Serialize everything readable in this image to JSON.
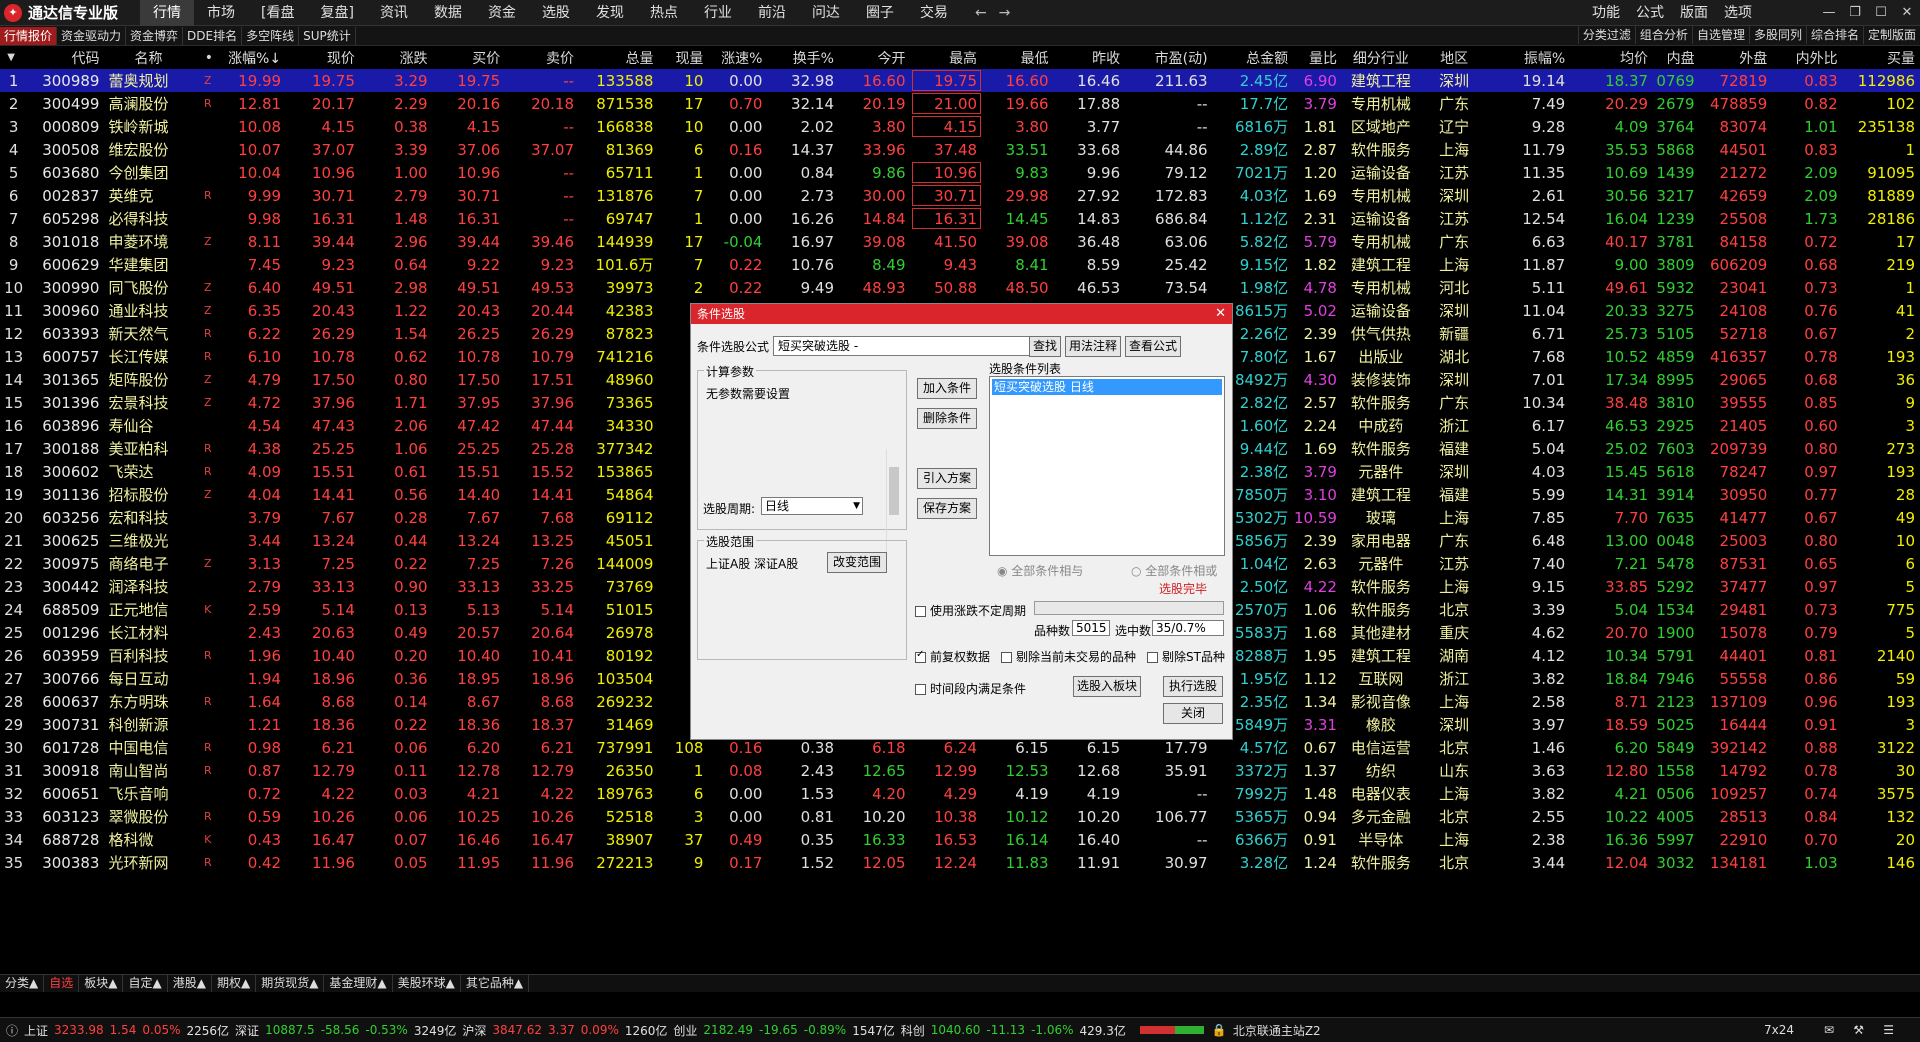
{
  "app": {
    "title": "通达信专业版"
  },
  "menu": [
    "行情",
    "市场",
    "[看盘",
    "复盘]",
    "资讯",
    "数据",
    "资金",
    "选股",
    "发现",
    "热点",
    "行业",
    "前沿",
    "问达",
    "圈子",
    "交易"
  ],
  "right_menu": [
    "功能",
    "公式",
    "版面",
    "选项"
  ],
  "tabs": [
    "行情报价",
    "资金驱动力",
    "资金博弈",
    "DDE排名",
    "多空阵线",
    "SUP统计"
  ],
  "right_tabs": [
    "分类过滤",
    "组合分析",
    "自选管理",
    "多股同列",
    "综合排名",
    "定制版面"
  ],
  "columns": [
    "代码",
    "名称",
    "•",
    "涨幅%↓",
    "现价",
    "涨跌",
    "买价",
    "卖价",
    "总量",
    "现量",
    "涨速%",
    "换手%",
    "今开",
    "最高",
    "最低",
    "昨收",
    "市盈(动)",
    "总金额",
    "量比",
    "细分行业",
    "地区",
    "振幅%",
    "均价",
    "内盘",
    "外盘",
    "内外比",
    "买量"
  ],
  "rows": [
    [
      "300989",
      "蕾奥规划",
      "Z",
      "19.99",
      "19.75",
      "3.29",
      "19.75",
      "--",
      "133588",
      "10",
      "0.00",
      "32.98",
      "16.60",
      "19.75",
      "16.60",
      "16.46",
      "211.63",
      "2.45亿",
      "6.90",
      "建筑工程",
      "深圳",
      "19.14",
      "18.37",
      "0769",
      "72819",
      "0.83",
      "112986"
    ],
    [
      "300499",
      "高澜股份",
      "R",
      "12.81",
      "20.17",
      "2.29",
      "20.16",
      "20.18",
      "871538",
      "17",
      "0.70",
      "32.14",
      "20.19",
      "21.00",
      "19.66",
      "17.88",
      "--",
      "17.7亿",
      "3.79",
      "专用机械",
      "广东",
      "7.49",
      "20.29",
      "2679",
      "478859",
      "0.82",
      "102"
    ],
    [
      "000809",
      "铁岭新城",
      "",
      "10.08",
      "4.15",
      "0.38",
      "4.15",
      "--",
      "166838",
      "10",
      "0.00",
      "2.02",
      "3.80",
      "4.15",
      "3.80",
      "3.77",
      "--",
      "6816万",
      "1.81",
      "区域地产",
      "辽宁",
      "9.28",
      "4.09",
      "3764",
      "83074",
      "1.01",
      "235138"
    ],
    [
      "300508",
      "维宏股份",
      "",
      "10.07",
      "37.07",
      "3.39",
      "37.06",
      "37.07",
      "81369",
      "6",
      "0.16",
      "14.37",
      "33.96",
      "37.48",
      "33.51",
      "33.68",
      "44.86",
      "2.89亿",
      "2.87",
      "软件服务",
      "上海",
      "11.79",
      "35.53",
      "5868",
      "44501",
      "0.83",
      "1"
    ],
    [
      "603680",
      "今创集团",
      "",
      "10.04",
      "10.96",
      "1.00",
      "10.96",
      "--",
      "65711",
      "1",
      "0.00",
      "0.84",
      "9.86",
      "10.96",
      "9.83",
      "9.96",
      "79.12",
      "7021万",
      "1.20",
      "运输设备",
      "江苏",
      "11.35",
      "10.69",
      "1439",
      "21272",
      "2.09",
      "91095"
    ],
    [
      "002837",
      "英维克",
      "R",
      "9.99",
      "30.71",
      "2.79",
      "30.71",
      "--",
      "131876",
      "7",
      "0.00",
      "2.73",
      "30.00",
      "30.71",
      "29.98",
      "27.92",
      "172.83",
      "4.03亿",
      "1.69",
      "专用机械",
      "深圳",
      "2.61",
      "30.56",
      "3217",
      "42659",
      "2.09",
      "81889"
    ],
    [
      "605298",
      "必得科技",
      "",
      "9.98",
      "16.31",
      "1.48",
      "16.31",
      "--",
      "69747",
      "1",
      "0.00",
      "16.26",
      "14.84",
      "16.31",
      "14.45",
      "14.83",
      "686.84",
      "1.12亿",
      "2.31",
      "运输设备",
      "江苏",
      "12.54",
      "16.04",
      "1239",
      "25508",
      "1.73",
      "28186"
    ],
    [
      "301018",
      "申菱环境",
      "Z",
      "8.11",
      "39.44",
      "2.96",
      "39.44",
      "39.46",
      "144939",
      "17",
      "-0.04",
      "16.97",
      "39.08",
      "41.50",
      "39.08",
      "36.48",
      "63.06",
      "5.82亿",
      "5.79",
      "专用机械",
      "广东",
      "6.63",
      "40.17",
      "3781",
      "84158",
      "0.72",
      "17"
    ],
    [
      "600629",
      "华建集团",
      "",
      "7.45",
      "9.23",
      "0.64",
      "9.22",
      "9.23",
      "101.6万",
      "7",
      "0.22",
      "10.76",
      "8.49",
      "9.43",
      "8.41",
      "8.59",
      "25.42",
      "9.15亿",
      "1.82",
      "建筑工程",
      "上海",
      "11.87",
      "9.00",
      "3809",
      "606209",
      "0.68",
      "219"
    ],
    [
      "300990",
      "同飞股份",
      "Z",
      "6.40",
      "49.51",
      "2.98",
      "49.51",
      "49.53",
      "39973",
      "2",
      "0.22",
      "9.49",
      "48.93",
      "50.88",
      "48.50",
      "46.53",
      "73.54",
      "1.98亿",
      "4.78",
      "专用机械",
      "河北",
      "5.11",
      "49.61",
      "5932",
      "23041",
      "0.73",
      "1"
    ],
    [
      "300960",
      "通业科技",
      "Z",
      "6.35",
      "20.43",
      "1.22",
      "20.43",
      "20.44",
      "42383",
      "",
      "",
      "",
      "",
      "",
      "",
      "",
      "",
      "8615万",
      "5.02",
      "运输设备",
      "深圳",
      "11.04",
      "20.33",
      "3275",
      "24108",
      "0.76",
      "41"
    ],
    [
      "603393",
      "新天然气",
      "R",
      "6.22",
      "26.29",
      "1.54",
      "26.25",
      "26.29",
      "87823",
      "",
      "",
      "",
      "",
      "",
      "",
      "",
      "",
      "2.26亿",
      "2.39",
      "供气供热",
      "新疆",
      "6.71",
      "25.73",
      "5105",
      "52718",
      "0.67",
      "2"
    ],
    [
      "600757",
      "长江传媒",
      "R",
      "6.10",
      "10.78",
      "0.62",
      "10.78",
      "10.79",
      "741216",
      "",
      "",
      "",
      "",
      "",
      "",
      "",
      "",
      "7.80亿",
      "1.67",
      "出版业",
      "湖北",
      "7.68",
      "10.52",
      "4859",
      "416357",
      "0.78",
      "193"
    ],
    [
      "301365",
      "矩阵股份",
      "Z",
      "4.79",
      "17.50",
      "0.80",
      "17.50",
      "17.51",
      "48960",
      "",
      "",
      "",
      "",
      "",
      "",
      "",
      "",
      "8492万",
      "4.30",
      "装修装饰",
      "深圳",
      "7.01",
      "17.34",
      "8995",
      "29065",
      "0.68",
      "36"
    ],
    [
      "301396",
      "宏景科技",
      "Z",
      "4.72",
      "37.96",
      "1.71",
      "37.95",
      "37.96",
      "73365",
      "",
      "",
      "",
      "",
      "",
      "",
      "",
      "",
      "2.82亿",
      "2.57",
      "软件服务",
      "广东",
      "10.34",
      "38.48",
      "3810",
      "39555",
      "0.85",
      "9"
    ],
    [
      "603896",
      "寿仙谷",
      "",
      "4.54",
      "47.43",
      "2.06",
      "47.42",
      "47.44",
      "34330",
      "",
      "",
      "",
      "",
      "",
      "",
      "",
      "",
      "1.60亿",
      "2.24",
      "中成药",
      "浙江",
      "6.17",
      "46.53",
      "2925",
      "21405",
      "0.60",
      "3"
    ],
    [
      "300188",
      "美亚柏科",
      "R",
      "4.38",
      "25.25",
      "1.06",
      "25.25",
      "25.28",
      "377342",
      "1",
      "",
      "",
      "",
      "",
      "",
      "",
      "",
      "9.44亿",
      "1.69",
      "软件服务",
      "福建",
      "5.04",
      "25.02",
      "7603",
      "209739",
      "0.80",
      "273"
    ],
    [
      "300602",
      "飞荣达",
      "R",
      "4.09",
      "15.51",
      "0.61",
      "15.51",
      "15.52",
      "153865",
      "",
      "",
      "",
      "",
      "",
      "",
      "",
      "",
      "2.38亿",
      "3.79",
      "元器件",
      "深圳",
      "4.03",
      "15.45",
      "5618",
      "78247",
      "0.97",
      "193"
    ],
    [
      "301136",
      "招标股份",
      "Z",
      "4.04",
      "14.41",
      "0.56",
      "14.40",
      "14.41",
      "54864",
      "",
      "",
      "",
      "",
      "",
      "",
      "",
      "",
      "7850万",
      "3.10",
      "建筑工程",
      "福建",
      "5.99",
      "14.31",
      "3914",
      "30950",
      "0.77",
      "28"
    ],
    [
      "603256",
      "宏和科技",
      "",
      "3.79",
      "7.67",
      "0.28",
      "7.67",
      "7.68",
      "69112",
      "",
      "",
      "",
      "",
      "",
      "",
      "",
      "",
      "5302万",
      "10.59",
      "玻璃",
      "上海",
      "7.85",
      "7.70",
      "7635",
      "41477",
      "0.67",
      "49"
    ],
    [
      "300625",
      "三维极光",
      "",
      "3.44",
      "13.24",
      "0.44",
      "13.24",
      "13.25",
      "45051",
      "",
      "",
      "",
      "",
      "",
      "",
      "",
      "",
      "5856万",
      "2.39",
      "家用电器",
      "广东",
      "6.48",
      "13.00",
      "0048",
      "25003",
      "0.80",
      "10"
    ],
    [
      "300975",
      "商络电子",
      "Z",
      "3.13",
      "7.25",
      "0.22",
      "7.25",
      "7.26",
      "144009",
      "",
      "",
      "",
      "",
      "",
      "",
      "",
      "",
      "1.04亿",
      "2.63",
      "元器件",
      "江苏",
      "7.40",
      "7.21",
      "5478",
      "87531",
      "0.65",
      "6"
    ],
    [
      "300442",
      "润泽科技",
      "",
      "2.79",
      "33.13",
      "0.90",
      "33.13",
      "33.25",
      "73769",
      "",
      "",
      "",
      "",
      "",
      "",
      "",
      "",
      "2.50亿",
      "4.22",
      "软件服务",
      "上海",
      "9.15",
      "33.85",
      "5292",
      "37477",
      "0.97",
      "5"
    ],
    [
      "688509",
      "正元地信",
      "K",
      "2.59",
      "5.14",
      "0.13",
      "5.13",
      "5.14",
      "51015",
      "",
      "",
      "",
      "",
      "",
      "",
      "",
      "",
      "2570万",
      "1.06",
      "软件服务",
      "北京",
      "3.39",
      "5.04",
      "1534",
      "29481",
      "0.73",
      "775"
    ],
    [
      "001296",
      "长江材料",
      "",
      "2.43",
      "20.63",
      "0.49",
      "20.57",
      "20.64",
      "26978",
      "",
      "",
      "",
      "",
      "",
      "",
      "",
      "",
      "5583万",
      "1.68",
      "其他建材",
      "重庆",
      "4.62",
      "20.70",
      "1900",
      "15078",
      "0.79",
      "5"
    ],
    [
      "603959",
      "百利科技",
      "R",
      "1.96",
      "10.40",
      "0.20",
      "10.40",
      "10.41",
      "80192",
      "",
      "",
      "",
      "",
      "",
      "",
      "",
      "",
      "8288万",
      "1.95",
      "建筑工程",
      "湖南",
      "4.12",
      "10.34",
      "5791",
      "44401",
      "0.81",
      "2140"
    ],
    [
      "300766",
      "每日互动",
      "",
      "1.94",
      "18.96",
      "0.36",
      "18.95",
      "18.96",
      "103504",
      "",
      "",
      "",
      "",
      "",
      "",
      "",
      "",
      "1.95亿",
      "1.12",
      "互联网",
      "浙江",
      "3.82",
      "18.84",
      "7946",
      "55558",
      "0.86",
      "59"
    ],
    [
      "600637",
      "东方明珠",
      "R",
      "1.64",
      "8.68",
      "0.14",
      "8.67",
      "8.68",
      "269232",
      "",
      "",
      "",
      "",
      "",
      "",
      "",
      "",
      "2.35亿",
      "1.34",
      "影视音像",
      "上海",
      "2.58",
      "8.71",
      "2123",
      "137109",
      "0.96",
      "193"
    ],
    [
      "300731",
      "科创新源",
      "",
      "1.21",
      "18.36",
      "0.22",
      "18.36",
      "18.37",
      "31469",
      "",
      "",
      "",
      "",
      "",
      "",
      "",
      "",
      "5849万",
      "3.31",
      "橡胶",
      "深圳",
      "3.97",
      "18.59",
      "5025",
      "16444",
      "0.91",
      "3"
    ],
    [
      "601728",
      "中国电信",
      "R",
      "0.98",
      "6.21",
      "0.06",
      "6.20",
      "6.21",
      "737991",
      "108",
      "0.16",
      "0.38",
      "6.18",
      "6.24",
      "6.15",
      "6.15",
      "17.79",
      "4.57亿",
      "0.67",
      "电信运营",
      "北京",
      "1.46",
      "6.20",
      "5849",
      "392142",
      "0.88",
      "3122"
    ],
    [
      "300918",
      "南山智尚",
      "R",
      "0.87",
      "12.79",
      "0.11",
      "12.78",
      "12.79",
      "26350",
      "1",
      "0.08",
      "2.43",
      "12.65",
      "12.99",
      "12.53",
      "12.68",
      "35.91",
      "3372万",
      "1.37",
      "纺织",
      "山东",
      "3.63",
      "12.80",
      "1558",
      "14792",
      "0.78",
      "30"
    ],
    [
      "600651",
      "飞乐音响",
      "",
      "0.72",
      "4.22",
      "0.03",
      "4.21",
      "4.22",
      "189763",
      "6",
      "0.00",
      "1.53",
      "4.20",
      "4.29",
      "4.19",
      "4.19",
      "--",
      "7992万",
      "1.48",
      "电器仪表",
      "上海",
      "3.82",
      "4.21",
      "0506",
      "109257",
      "0.74",
      "3575"
    ],
    [
      "603123",
      "翠微股份",
      "R",
      "0.59",
      "10.26",
      "0.06",
      "10.25",
      "10.26",
      "52518",
      "3",
      "0.00",
      "0.81",
      "10.20",
      "10.38",
      "10.12",
      "10.20",
      "106.77",
      "5365万",
      "0.94",
      "多元金融",
      "北京",
      "2.55",
      "10.22",
      "4005",
      "28513",
      "0.84",
      "132"
    ],
    [
      "688728",
      "格科微",
      "K",
      "0.43",
      "16.47",
      "0.07",
      "16.46",
      "16.47",
      "38907",
      "37",
      "0.49",
      "0.35",
      "16.33",
      "16.53",
      "16.14",
      "16.40",
      "--",
      "6366万",
      "0.91",
      "半导体",
      "上海",
      "2.38",
      "16.36",
      "5997",
      "22910",
      "0.70",
      "20"
    ],
    [
      "300383",
      "光环新网",
      "R",
      "0.42",
      "11.96",
      "0.05",
      "11.95",
      "11.96",
      "272213",
      "9",
      "0.17",
      "1.52",
      "12.05",
      "12.24",
      "11.83",
      "11.91",
      "30.97",
      "3.28亿",
      "1.24",
      "软件服务",
      "北京",
      "3.44",
      "12.04",
      "3032",
      "134181",
      "1.03",
      "146"
    ]
  ],
  "bottom_tabs": [
    "分类▲",
    "自选",
    "板块▲",
    "自定▲",
    "港股▲",
    "期权▲",
    "期货现货▲",
    "基金理财▲",
    "美股环球▲",
    "其它品种▲"
  ],
  "status": {
    "sh_label": "上证",
    "sh_val": "3233.98",
    "sh_chg": "1.54",
    "sh_pct": "0.05%",
    "sh_amt": "2256亿",
    "sz_label": "深证",
    "sz_val": "10887.5",
    "sz_chg": "-58.56",
    "sz_pct": "-0.53%",
    "sz_amt": "3249亿",
    "hs_label": "沪深",
    "hs_val": "3847.62",
    "hs_chg": "3.37",
    "hs_pct": "0.09%",
    "hs_amt": "1260亿",
    "cy_label": "创业",
    "cy_val": "2182.49",
    "cy_chg": "-19.65",
    "cy_pct": "-0.89%",
    "cy_amt": "1547亿",
    "kc_label": "科创",
    "kc_val": "1040.60",
    "kc_chg": "-11.13",
    "kc_pct": "-1.06%",
    "kc_amt": "429.3亿",
    "server": "北京联通主站Z2",
    "mode": "7x24"
  },
  "dialog": {
    "title": "条件选股",
    "formula_label": "条件选股公式",
    "formula_value": "短买突破选股 -",
    "find": "查找",
    "usage": "用法注释",
    "view_formula": "查看公式",
    "params_group": "计算参数",
    "params_text": "无参数需要设置",
    "add_cond": "加入条件",
    "del_cond": "删除条件",
    "import_plan": "引入方案",
    "save_plan": "保存方案",
    "list_label": "选股条件列表",
    "list_item": "短买突破选股  日线",
    "period_label": "选股周期:",
    "period_value": "日线",
    "all_and": "全部条件相与",
    "all_or": "全部条件相或",
    "done": "选股完毕",
    "range_group": "选股范围",
    "range_text": "上证A股 深证A股",
    "change_range": "改变范围",
    "use_period": "使用涨跌不定周期",
    "count_label": "品种数",
    "count_value": "5015",
    "selected_label": "选中数",
    "selected_value": "35/0.7%",
    "fq": "前复权数据",
    "skip_untraded": "剔除当前未交易的品种",
    "skip_st": "剔除ST品种",
    "time_range": "时间段内满足条件",
    "to_block": "选股入板块",
    "run": "执行选股",
    "close": "关闭"
  }
}
